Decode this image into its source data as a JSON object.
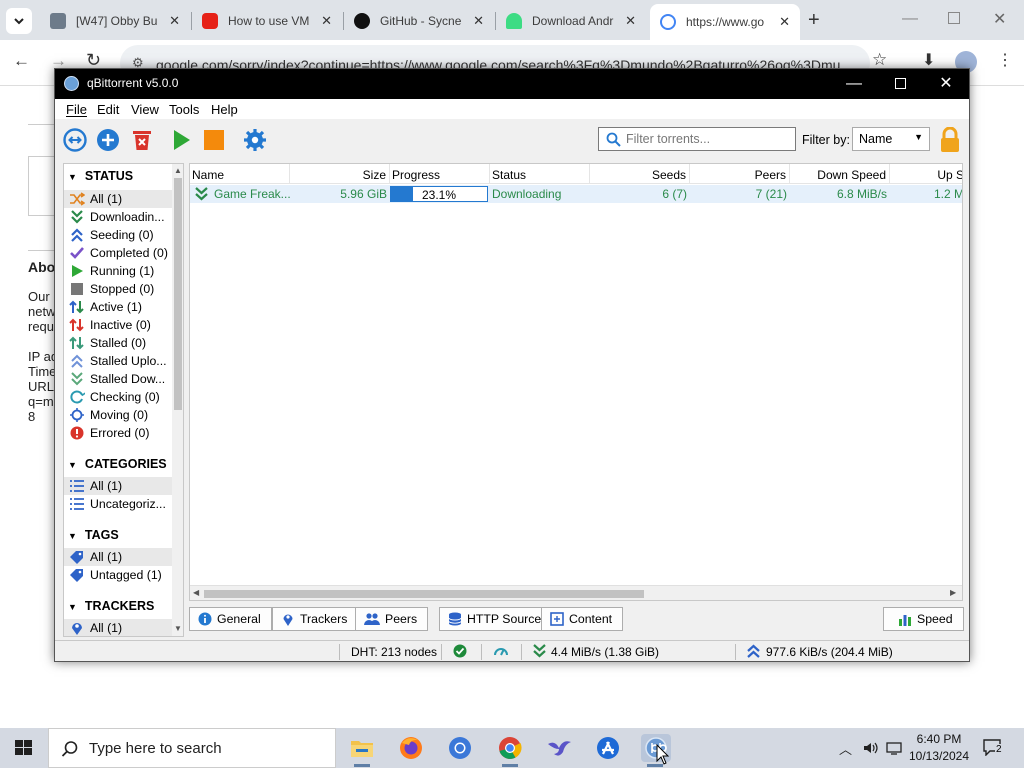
{
  "browser": {
    "tabs": [
      {
        "title": "[W47] Obby Bu",
        "color": "#6d7b8a"
      },
      {
        "title": "How to use VM",
        "color": "#e62117"
      },
      {
        "title": "GitHub - Sycne",
        "color": "#111111"
      },
      {
        "title": "Download Andr",
        "color": "#3ddc84"
      },
      {
        "title": "https://www.go",
        "color": "#4285f4"
      }
    ],
    "url": "google.com/sorry/index?continue=https://www.google.com/search%3Fq%3Dmundo%2Bgaturro%26oq%3Dmu",
    "page_text": {
      "heading": "Abo",
      "lines": [
        "Our",
        "netw",
        "requ",
        "",
        "IP ad",
        "Time",
        "URL",
        "q=m",
        "8"
      ]
    }
  },
  "qbt": {
    "title": "qBittorrent v5.0.0",
    "menu": [
      {
        "label": "File",
        "key": "F"
      },
      {
        "label": "Edit",
        "key": "E"
      },
      {
        "label": "View",
        "key": "V"
      },
      {
        "label": "Tools",
        "key": "T"
      },
      {
        "label": "Help",
        "key": "H"
      }
    ],
    "toolbar": {
      "filter_placeholder": "Filter torrents...",
      "filter_by_label": "Filter by:",
      "filter_by_value": "Name"
    },
    "sidebar": {
      "status_header": "STATUS",
      "status_items": [
        {
          "label": "All (1)",
          "icon": "shuffle-icon",
          "color": "#e0821f"
        },
        {
          "label": "Downloadin...",
          "icon": "download-icon",
          "color": "#2a8a4a"
        },
        {
          "label": "Seeding (0)",
          "icon": "upload-icon",
          "color": "#2e63c8"
        },
        {
          "label": "Completed (0)",
          "icon": "checkmark-icon",
          "color": "#7a52c8"
        },
        {
          "label": "Running (1)",
          "icon": "play-icon",
          "color": "#2ea836"
        },
        {
          "label": "Stopped (0)",
          "icon": "stop-icon",
          "color": "#777777"
        },
        {
          "label": "Active (1)",
          "icon": "active-arrows-icon",
          "color": "#2a8a4a"
        },
        {
          "label": "Inactive (0)",
          "icon": "inactive-arrows-icon",
          "color": "#d9342b"
        },
        {
          "label": "Stalled (0)",
          "icon": "stalled-arrows-icon",
          "color": "#3a9a7a"
        },
        {
          "label": "Stalled Uplo...",
          "icon": "stalled-upload-icon",
          "color": "#2e63c8"
        },
        {
          "label": "Stalled Dow...",
          "icon": "stalled-download-icon",
          "color": "#2a8a4a"
        },
        {
          "label": "Checking (0)",
          "icon": "checking-icon",
          "color": "#2a9ab0"
        },
        {
          "label": "Moving (0)",
          "icon": "moving-icon",
          "color": "#2e63c8"
        },
        {
          "label": "Errored (0)",
          "icon": "error-icon",
          "color": "#d9342b"
        }
      ],
      "categories_header": "CATEGORIES",
      "categories_items": [
        {
          "label": "All (1)"
        },
        {
          "label": "Uncategoriz..."
        }
      ],
      "tags_header": "TAGS",
      "tags_items": [
        {
          "label": "All (1)"
        },
        {
          "label": "Untagged (1)"
        }
      ],
      "trackers_header": "TRACKERS",
      "trackers_items": [
        {
          "label": "All (1)"
        }
      ]
    },
    "columns": [
      "Name",
      "Size",
      "Progress",
      "Status",
      "Seeds",
      "Peers",
      "Down Speed",
      "Up S"
    ],
    "torrent": {
      "name": "Game Freak...",
      "size": "5.96 GiB",
      "progress_text": "23.1%",
      "progress_fraction": 0.231,
      "status": "Downloading",
      "seeds": "6 (7)",
      "peers": "7 (21)",
      "down_speed": "6.8 MiB/s",
      "up_speed": "1.2 M"
    },
    "bottom_tabs": [
      "General",
      "Trackers",
      "Peers",
      "HTTP Sources",
      "Content"
    ],
    "speed_button": "Speed",
    "statusbar": {
      "dht": "DHT: 213 nodes",
      "down": "4.4 MiB/s (1.38 GiB)",
      "up": "977.6 KiB/s (204.4 MiB)"
    }
  },
  "taskbar": {
    "search_placeholder": "Type here to search",
    "time": "6:40 PM",
    "date": "10/13/2024",
    "notifications": "2"
  }
}
